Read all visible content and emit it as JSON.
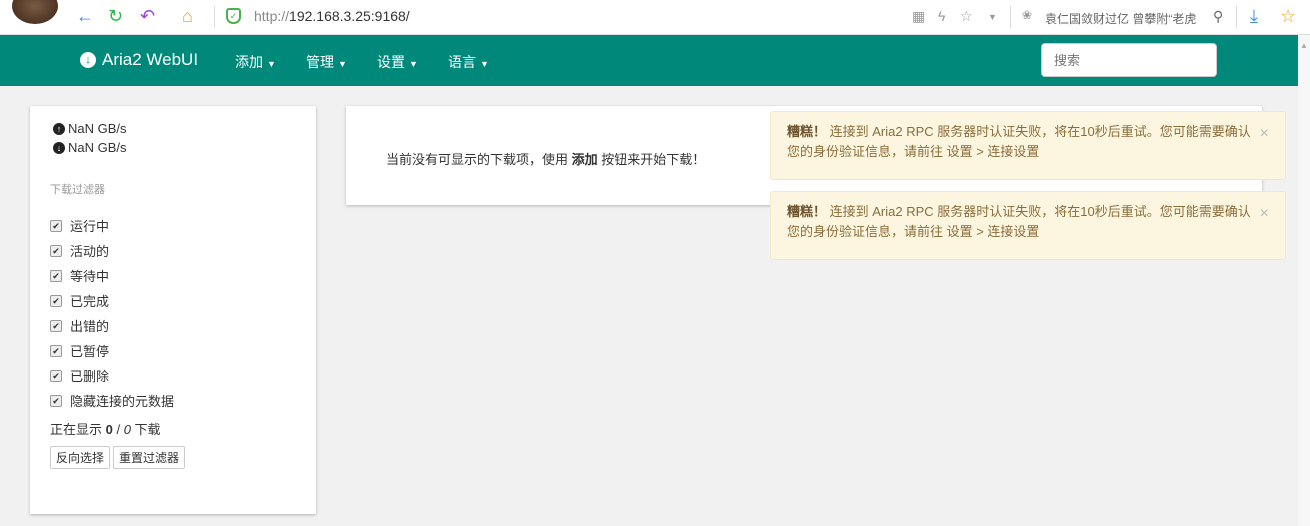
{
  "browser": {
    "url_proto": "http://",
    "url_host": "192.168.3.25:9168/",
    "search_suggestion": "袁仁国敛财过亿 曾攀附“老虎"
  },
  "navbar": {
    "brand": "Aria2 WebUI",
    "menus": [
      "添加",
      "管理",
      "设置",
      "语言"
    ],
    "search_placeholder": "搜索",
    "color": "#00897b"
  },
  "sidebar": {
    "upload_speed": "NaN GB/s",
    "download_speed": "NaN GB/s",
    "filter_title": "下载过滤器",
    "filters": [
      {
        "label": "运行中",
        "checked": true
      },
      {
        "label": "活动的",
        "checked": true
      },
      {
        "label": "等待中",
        "checked": true
      },
      {
        "label": "已完成",
        "checked": true
      },
      {
        "label": "出错的",
        "checked": true
      },
      {
        "label": "已暂停",
        "checked": true
      },
      {
        "label": "已删除",
        "checked": true
      },
      {
        "label": "隐藏连接的元数据",
        "checked": true
      }
    ],
    "count_prefix": "正在显示 ",
    "count_shown": "0",
    "count_sep": " / ",
    "count_total": "0",
    "count_suffix": " 下载",
    "invert_button": "反向选择",
    "reset_button": "重置过滤器"
  },
  "main": {
    "empty_prefix": "当前没有可显示的下载项，使用 ",
    "empty_bold": "添加",
    "empty_suffix": " 按钮来开始下载！"
  },
  "alerts": [
    {
      "title": "糟糕！",
      "message": " 连接到 Aria2 RPC 服务器时认证失败，将在10秒后重试。您可能需要确认您的身份验证信息，请前往 设置 > 连接设置"
    },
    {
      "title": "糟糕！",
      "message": " 连接到 Aria2 RPC 服务器时认证失败，将在10秒后重试。您可能需要确认您的身份验证信息，请前往 设置 > 连接设置"
    }
  ]
}
